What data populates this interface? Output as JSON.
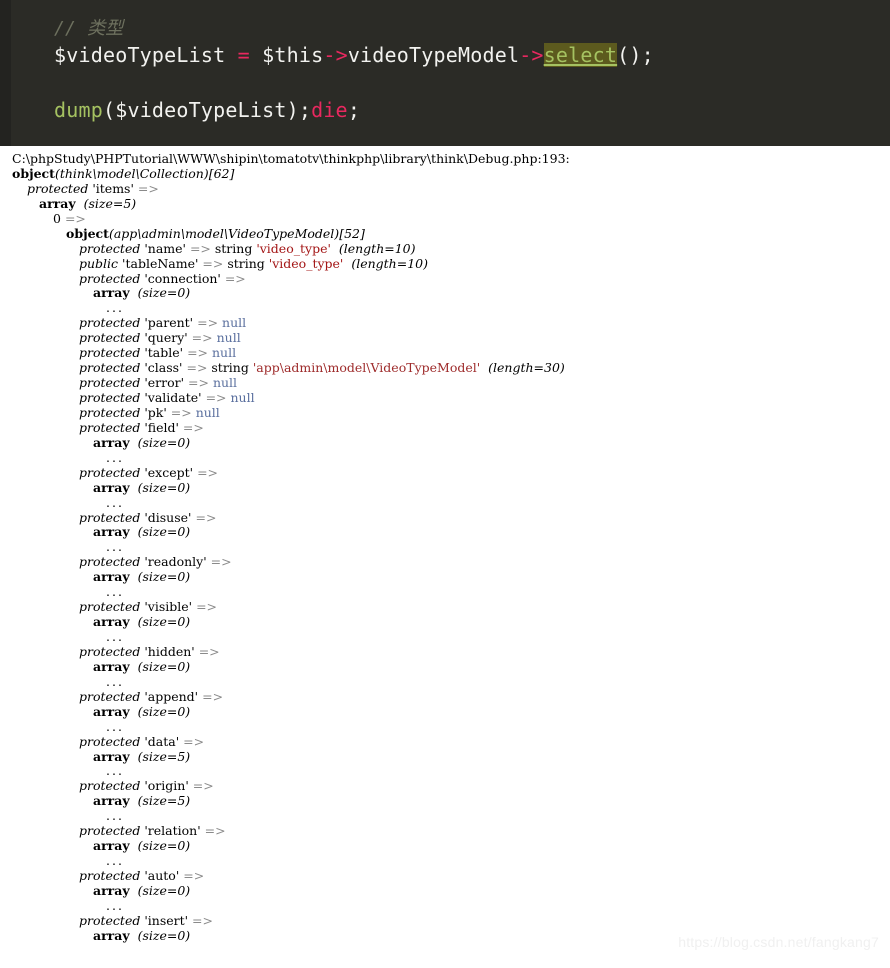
{
  "code_block": {
    "background": "#2b2b26",
    "gutter_color": "#232320",
    "highlight_bg": "#5c5a1e",
    "lines": [
      {
        "id": "comment",
        "segments": [
          {
            "cls": "tok-comment",
            "text": "// 类型"
          }
        ]
      },
      {
        "id": "assign",
        "segments": [
          {
            "cls": "tok-plain",
            "text": "$videoTypeList "
          },
          {
            "cls": "tok-op",
            "text": "="
          },
          {
            "cls": "tok-plain",
            "text": " $this"
          },
          {
            "cls": "tok-arrow",
            "text": "->"
          },
          {
            "cls": "tok-plain",
            "text": "videoTypeModel"
          },
          {
            "cls": "tok-arrow",
            "text": "->"
          },
          {
            "cls": "tok-sel",
            "text": "select"
          },
          {
            "cls": "tok-plain",
            "text": "();"
          }
        ]
      },
      {
        "id": "blank",
        "segments": [
          {
            "cls": "tok-plain",
            "text": " "
          }
        ]
      },
      {
        "id": "dump",
        "segments": [
          {
            "cls": "tok-func",
            "text": "dump"
          },
          {
            "cls": "tok-plain",
            "text": "($videoTypeList);"
          },
          {
            "cls": "tok-kw",
            "text": "die"
          },
          {
            "cls": "tok-plain",
            "text": ";"
          }
        ]
      }
    ]
  },
  "dump_output": {
    "file_path": "C:\\phpStudy\\PHPTutorial\\WWW\\shipin\\tomatotv\\thinkphp\\library\\think\\Debug.php:193:",
    "root_type": "object",
    "root_class": "(think\\model\\Collection)",
    "root_id": "[62]",
    "lines": [
      {
        "indent": 0,
        "segments": [
          {
            "cls": "d-path",
            "text": "C:\\phpStudy\\PHPTutorial\\WWW\\shipin\\tomatotv\\thinkphp\\library\\think\\Debug.php:193:"
          }
        ]
      },
      {
        "indent": 0,
        "segments": [
          {
            "cls": "d-object",
            "text": "object"
          },
          {
            "cls": "d-class",
            "text": "(think\\model\\Collection)"
          },
          {
            "cls": "d-id",
            "text": "[62]"
          }
        ]
      },
      {
        "indent": 1,
        "segments": [
          {
            "cls": "d-mod",
            "text": "protected"
          },
          {
            "cls": "d-key",
            "text": " 'items' "
          },
          {
            "cls": "d-arrow",
            "text": "=>"
          }
        ]
      },
      {
        "indent": 2,
        "segments": [
          {
            "cls": "d-array",
            "text": "array"
          },
          {
            "cls": "d-size",
            "text": "  (size=5)"
          }
        ]
      },
      {
        "indent": 3,
        "segments": [
          {
            "cls": "d-idx",
            "text": "0 "
          },
          {
            "cls": "d-arrow",
            "text": "=>"
          }
        ]
      },
      {
        "indent": 4,
        "segments": [
          {
            "cls": "d-object",
            "text": "object"
          },
          {
            "cls": "d-class",
            "text": "(app\\admin\\model\\VideoTypeModel)"
          },
          {
            "cls": "d-id",
            "text": "[52]"
          }
        ]
      },
      {
        "indent": 5,
        "segments": [
          {
            "cls": "d-mod",
            "text": "protected"
          },
          {
            "cls": "d-key",
            "text": " 'name' "
          },
          {
            "cls": "d-arrow",
            "text": "=>"
          },
          {
            "cls": "d-type",
            "text": " string "
          },
          {
            "cls": "d-str",
            "text": "'video_type'"
          },
          {
            "cls": "d-len",
            "text": "  (length=10)"
          }
        ]
      },
      {
        "indent": 5,
        "segments": [
          {
            "cls": "d-mod",
            "text": "public"
          },
          {
            "cls": "d-key",
            "text": " 'tableName' "
          },
          {
            "cls": "d-arrow",
            "text": "=>"
          },
          {
            "cls": "d-type",
            "text": " string "
          },
          {
            "cls": "d-str",
            "text": "'video_type'"
          },
          {
            "cls": "d-len",
            "text": "  (length=10)"
          }
        ]
      },
      {
        "indent": 5,
        "segments": [
          {
            "cls": "d-mod",
            "text": "protected"
          },
          {
            "cls": "d-key",
            "text": " 'connection' "
          },
          {
            "cls": "d-arrow",
            "text": "=>"
          }
        ]
      },
      {
        "indent": 6,
        "segments": [
          {
            "cls": "d-array",
            "text": "array"
          },
          {
            "cls": "d-size",
            "text": "  (size=0)"
          }
        ]
      },
      {
        "indent": 7,
        "segments": [
          {
            "cls": "d-dots",
            "text": "..."
          }
        ]
      },
      {
        "indent": 5,
        "segments": [
          {
            "cls": "d-mod",
            "text": "protected"
          },
          {
            "cls": "d-key",
            "text": " 'parent' "
          },
          {
            "cls": "d-arrow",
            "text": "=>"
          },
          {
            "cls": "d-null",
            "text": " null"
          }
        ]
      },
      {
        "indent": 5,
        "segments": [
          {
            "cls": "d-mod",
            "text": "protected"
          },
          {
            "cls": "d-key",
            "text": " 'query' "
          },
          {
            "cls": "d-arrow",
            "text": "=>"
          },
          {
            "cls": "d-null",
            "text": " null"
          }
        ]
      },
      {
        "indent": 5,
        "segments": [
          {
            "cls": "d-mod",
            "text": "protected"
          },
          {
            "cls": "d-key",
            "text": " 'table' "
          },
          {
            "cls": "d-arrow",
            "text": "=>"
          },
          {
            "cls": "d-null",
            "text": " null"
          }
        ]
      },
      {
        "indent": 5,
        "segments": [
          {
            "cls": "d-mod",
            "text": "protected"
          },
          {
            "cls": "d-key",
            "text": " 'class' "
          },
          {
            "cls": "d-arrow",
            "text": "=>"
          },
          {
            "cls": "d-type",
            "text": " string "
          },
          {
            "cls": "d-str2",
            "text": "'app\\admin\\model\\VideoTypeModel'"
          },
          {
            "cls": "d-len",
            "text": "  (length=30)"
          }
        ]
      },
      {
        "indent": 5,
        "segments": [
          {
            "cls": "d-mod",
            "text": "protected"
          },
          {
            "cls": "d-key",
            "text": " 'error' "
          },
          {
            "cls": "d-arrow",
            "text": "=>"
          },
          {
            "cls": "d-null",
            "text": " null"
          }
        ]
      },
      {
        "indent": 5,
        "segments": [
          {
            "cls": "d-mod",
            "text": "protected"
          },
          {
            "cls": "d-key",
            "text": " 'validate' "
          },
          {
            "cls": "d-arrow",
            "text": "=>"
          },
          {
            "cls": "d-null",
            "text": " null"
          }
        ]
      },
      {
        "indent": 5,
        "segments": [
          {
            "cls": "d-mod",
            "text": "protected"
          },
          {
            "cls": "d-key",
            "text": " 'pk' "
          },
          {
            "cls": "d-arrow",
            "text": "=>"
          },
          {
            "cls": "d-null",
            "text": " null"
          }
        ]
      },
      {
        "indent": 5,
        "segments": [
          {
            "cls": "d-mod",
            "text": "protected"
          },
          {
            "cls": "d-key",
            "text": " 'field' "
          },
          {
            "cls": "d-arrow",
            "text": "=>"
          }
        ]
      },
      {
        "indent": 6,
        "segments": [
          {
            "cls": "d-array",
            "text": "array"
          },
          {
            "cls": "d-size",
            "text": "  (size=0)"
          }
        ]
      },
      {
        "indent": 7,
        "segments": [
          {
            "cls": "d-dots",
            "text": "..."
          }
        ]
      },
      {
        "indent": 5,
        "segments": [
          {
            "cls": "d-mod",
            "text": "protected"
          },
          {
            "cls": "d-key",
            "text": " 'except' "
          },
          {
            "cls": "d-arrow",
            "text": "=>"
          }
        ]
      },
      {
        "indent": 6,
        "segments": [
          {
            "cls": "d-array",
            "text": "array"
          },
          {
            "cls": "d-size",
            "text": "  (size=0)"
          }
        ]
      },
      {
        "indent": 7,
        "segments": [
          {
            "cls": "d-dots",
            "text": "..."
          }
        ]
      },
      {
        "indent": 5,
        "segments": [
          {
            "cls": "d-mod",
            "text": "protected"
          },
          {
            "cls": "d-key",
            "text": " 'disuse' "
          },
          {
            "cls": "d-arrow",
            "text": "=>"
          }
        ]
      },
      {
        "indent": 6,
        "segments": [
          {
            "cls": "d-array",
            "text": "array"
          },
          {
            "cls": "d-size",
            "text": "  (size=0)"
          }
        ]
      },
      {
        "indent": 7,
        "segments": [
          {
            "cls": "d-dots",
            "text": "..."
          }
        ]
      },
      {
        "indent": 5,
        "segments": [
          {
            "cls": "d-mod",
            "text": "protected"
          },
          {
            "cls": "d-key",
            "text": " 'readonly' "
          },
          {
            "cls": "d-arrow",
            "text": "=>"
          }
        ]
      },
      {
        "indent": 6,
        "segments": [
          {
            "cls": "d-array",
            "text": "array"
          },
          {
            "cls": "d-size",
            "text": "  (size=0)"
          }
        ]
      },
      {
        "indent": 7,
        "segments": [
          {
            "cls": "d-dots",
            "text": "..."
          }
        ]
      },
      {
        "indent": 5,
        "segments": [
          {
            "cls": "d-mod",
            "text": "protected"
          },
          {
            "cls": "d-key",
            "text": " 'visible' "
          },
          {
            "cls": "d-arrow",
            "text": "=>"
          }
        ]
      },
      {
        "indent": 6,
        "segments": [
          {
            "cls": "d-array",
            "text": "array"
          },
          {
            "cls": "d-size",
            "text": "  (size=0)"
          }
        ]
      },
      {
        "indent": 7,
        "segments": [
          {
            "cls": "d-dots",
            "text": "..."
          }
        ]
      },
      {
        "indent": 5,
        "segments": [
          {
            "cls": "d-mod",
            "text": "protected"
          },
          {
            "cls": "d-key",
            "text": " 'hidden' "
          },
          {
            "cls": "d-arrow",
            "text": "=>"
          }
        ]
      },
      {
        "indent": 6,
        "segments": [
          {
            "cls": "d-array",
            "text": "array"
          },
          {
            "cls": "d-size",
            "text": "  (size=0)"
          }
        ]
      },
      {
        "indent": 7,
        "segments": [
          {
            "cls": "d-dots",
            "text": "..."
          }
        ]
      },
      {
        "indent": 5,
        "segments": [
          {
            "cls": "d-mod",
            "text": "protected"
          },
          {
            "cls": "d-key",
            "text": " 'append' "
          },
          {
            "cls": "d-arrow",
            "text": "=>"
          }
        ]
      },
      {
        "indent": 6,
        "segments": [
          {
            "cls": "d-array",
            "text": "array"
          },
          {
            "cls": "d-size",
            "text": "  (size=0)"
          }
        ]
      },
      {
        "indent": 7,
        "segments": [
          {
            "cls": "d-dots",
            "text": "..."
          }
        ]
      },
      {
        "indent": 5,
        "segments": [
          {
            "cls": "d-mod",
            "text": "protected"
          },
          {
            "cls": "d-key",
            "text": " 'data' "
          },
          {
            "cls": "d-arrow",
            "text": "=>"
          }
        ]
      },
      {
        "indent": 6,
        "segments": [
          {
            "cls": "d-array",
            "text": "array"
          },
          {
            "cls": "d-size",
            "text": "  (size=5)"
          }
        ]
      },
      {
        "indent": 7,
        "segments": [
          {
            "cls": "d-dots",
            "text": "..."
          }
        ]
      },
      {
        "indent": 5,
        "segments": [
          {
            "cls": "d-mod",
            "text": "protected"
          },
          {
            "cls": "d-key",
            "text": " 'origin' "
          },
          {
            "cls": "d-arrow",
            "text": "=>"
          }
        ]
      },
      {
        "indent": 6,
        "segments": [
          {
            "cls": "d-array",
            "text": "array"
          },
          {
            "cls": "d-size",
            "text": "  (size=5)"
          }
        ]
      },
      {
        "indent": 7,
        "segments": [
          {
            "cls": "d-dots",
            "text": "..."
          }
        ]
      },
      {
        "indent": 5,
        "segments": [
          {
            "cls": "d-mod",
            "text": "protected"
          },
          {
            "cls": "d-key",
            "text": " 'relation' "
          },
          {
            "cls": "d-arrow",
            "text": "=>"
          }
        ]
      },
      {
        "indent": 6,
        "segments": [
          {
            "cls": "d-array",
            "text": "array"
          },
          {
            "cls": "d-size",
            "text": "  (size=0)"
          }
        ]
      },
      {
        "indent": 7,
        "segments": [
          {
            "cls": "d-dots",
            "text": "..."
          }
        ]
      },
      {
        "indent": 5,
        "segments": [
          {
            "cls": "d-mod",
            "text": "protected"
          },
          {
            "cls": "d-key",
            "text": " 'auto' "
          },
          {
            "cls": "d-arrow",
            "text": "=>"
          }
        ]
      },
      {
        "indent": 6,
        "segments": [
          {
            "cls": "d-array",
            "text": "array"
          },
          {
            "cls": "d-size",
            "text": "  (size=0)"
          }
        ]
      },
      {
        "indent": 7,
        "segments": [
          {
            "cls": "d-dots",
            "text": "..."
          }
        ]
      },
      {
        "indent": 5,
        "segments": [
          {
            "cls": "d-mod",
            "text": "protected"
          },
          {
            "cls": "d-key",
            "text": " 'insert' "
          },
          {
            "cls": "d-arrow",
            "text": "=>"
          }
        ]
      },
      {
        "indent": 6,
        "segments": [
          {
            "cls": "d-array",
            "text": "array"
          },
          {
            "cls": "d-size",
            "text": "  (size=0)"
          }
        ]
      }
    ]
  },
  "watermark": {
    "text": "https://blog.csdn.net/fangkang7"
  }
}
